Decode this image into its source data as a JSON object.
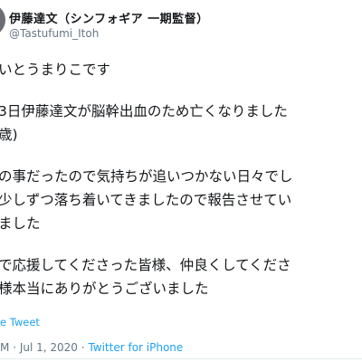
{
  "user": {
    "display_name": "伊藤達文（シンフォギア 一期監督）",
    "handle": "@Tastufumi_Itoh"
  },
  "tweet": {
    "lines": [
      "いとうまりこです",
      "3日伊藤達文が脳幹出血のため亡くなりました",
      "歳)",
      "の事だったので気持ちが追いつかない日々でし",
      "少しずつ落ち着いてきましたので報告させてい",
      "ました",
      "で応援してくださった皆様、仲良くしてくださ",
      "様本当にありがとうございました"
    ],
    "translate_label": "e Tweet"
  },
  "meta": {
    "time_fragment": "M",
    "date": "Jul 1, 2020",
    "separator": "·",
    "source": "Twitter for iPhone"
  }
}
